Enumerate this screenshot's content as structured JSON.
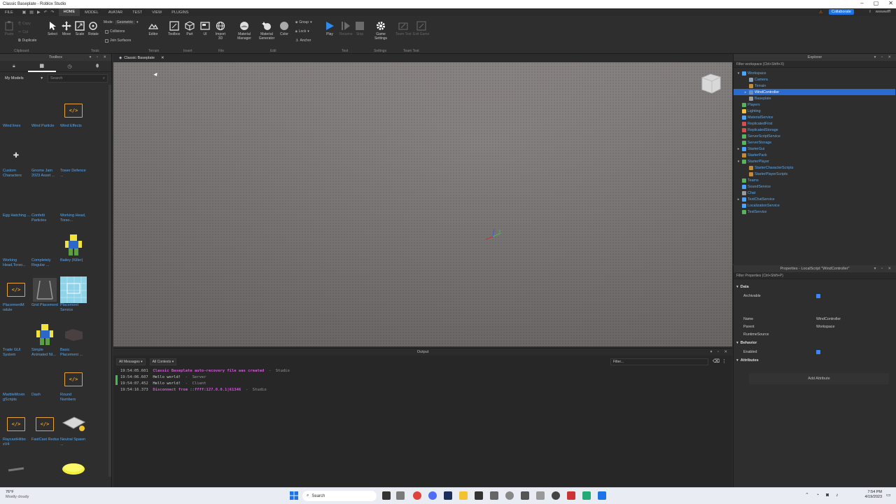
{
  "window": {
    "title": "Classic Baseplate - Roblox Studio"
  },
  "menubar": {
    "items": [
      "FILE",
      "HOME",
      "MODEL",
      "AVATAR",
      "TEST",
      "VIEW",
      "PLUGINS"
    ],
    "active": "HOME",
    "collaborate": "Collaborate",
    "user": "wwwwefff"
  },
  "ribbon": {
    "clipboard": {
      "copy": "Copy",
      "cut": "Cut",
      "duplicate": "Duplicate",
      "paste": "Paste",
      "label": "Clipboard"
    },
    "tools": {
      "select": "Select",
      "move": "Move",
      "scale": "Scale",
      "rotate": "Rotate",
      "mode_label": "Mode:",
      "mode_value": "Geometric",
      "collisions": "Collisions",
      "join_surfaces": "Join Surfaces",
      "label": "Tools"
    },
    "terrain": {
      "editor": "Editor",
      "label": "Terrain"
    },
    "insert": {
      "toolbox": "Toolbox",
      "part": "Part",
      "ui": "UI",
      "import3d": "Import 3D",
      "label": "Insert"
    },
    "file": {
      "material_manager": "Material Manager",
      "label": "File"
    },
    "edit": {
      "material_generator": "Material Generator",
      "color": "Color",
      "group": "Group",
      "lock": "Lock",
      "anchor": "Anchor",
      "label": "Edit"
    },
    "test": {
      "play": "Play",
      "resume": "Resume",
      "stop": "Stop",
      "label": "Test"
    },
    "settings": {
      "game_settings": "Game Settings",
      "label": "Settings"
    },
    "team_test": {
      "team_test": "Team Test",
      "exit_game": "Exit Game",
      "label": "Team Test"
    }
  },
  "toolbox": {
    "title": "Toolbox",
    "category": "My Models",
    "search_placeholder": "Search",
    "items": [
      {
        "label": "Wind lines",
        "thumb": "none"
      },
      {
        "label": "Wind Particle",
        "thumb": "none"
      },
      {
        "label": "Wind Effects",
        "thumb": "script"
      },
      {
        "label": "Custom Characters",
        "thumb": "figure"
      },
      {
        "label": "Gnome Jam 2023 Asset ...",
        "thumb": "none"
      },
      {
        "label": "Tower Defence ...",
        "thumb": "none"
      },
      {
        "label": "Egg Hatching ...",
        "thumb": "none"
      },
      {
        "label": "Confetti Particles",
        "thumb": "none"
      },
      {
        "label": "Working Head, Torso...",
        "thumb": "none"
      },
      {
        "label": "Working Head,Torso...",
        "thumb": "none"
      },
      {
        "label": "Completely Regular ...",
        "thumb": "none"
      },
      {
        "label": "Bailey (Killer)",
        "thumb": "noob"
      },
      {
        "label": "PlacementM odule",
        "thumb": "script"
      },
      {
        "label": "Grid Placement",
        "thumb": "grid"
      },
      {
        "label": "Placement Service",
        "thumb": "blueprint"
      },
      {
        "label": "Trade GUI System",
        "thumb": "none"
      },
      {
        "label": "Simple Animated NI...",
        "thumb": "noob"
      },
      {
        "label": "Basic Placement ...",
        "thumb": "box"
      },
      {
        "label": "MarbleMovin gScripts",
        "thumb": "none"
      },
      {
        "label": "Dash",
        "thumb": "none"
      },
      {
        "label": "Round Numbers",
        "thumb": "script"
      },
      {
        "label": "RaycastHitbo xV4",
        "thumb": "script"
      },
      {
        "label": "FastCast Redux",
        "thumb": "script"
      },
      {
        "label": "Neutral Spawn ...",
        "thumb": "spawn"
      },
      {
        "label": "",
        "thumb": "bar"
      },
      {
        "label": "",
        "thumb": "none"
      },
      {
        "label": "",
        "thumb": "disc"
      }
    ]
  },
  "doc_tab": {
    "label": "Classic Baseplate"
  },
  "output": {
    "title": "Output",
    "filter_messages": "All Messages",
    "filter_contexts": "All Contexts",
    "filter_placeholder": "Filter...",
    "lines": [
      {
        "time": "19:54:05.601",
        "msg": "Classic Baseplate auto-recovery file was created",
        "src": "Studio",
        "style": "mag"
      },
      {
        "time": "19:54:06.607",
        "msg": "Hello world!",
        "src": "Server",
        "style": "normal"
      },
      {
        "time": "19:54:07.452",
        "msg": "Hello world!",
        "src": "Client",
        "style": "normal"
      },
      {
        "time": "19:54:16.373",
        "msg": "Disconnect from ::ffff:127.0.0.1|61346",
        "src": "Studio",
        "style": "mag"
      }
    ]
  },
  "explorer": {
    "title": "Explorer",
    "filter_placeholder": "Filter workspace (Ctrl+Shift+X)",
    "tree": [
      {
        "label": "Workspace",
        "depth": 0,
        "arrow": "▾",
        "color": "#4aa3ff"
      },
      {
        "label": "Camera",
        "depth": 1,
        "arrow": "",
        "color": "#8aa0b8"
      },
      {
        "label": "Terrain",
        "depth": 1,
        "arrow": "",
        "color": "#c48a3a"
      },
      {
        "label": "WindController",
        "depth": 1,
        "arrow": "▸",
        "color": "#6a8fc0",
        "selected": true
      },
      {
        "label": "Baseplate",
        "depth": 1,
        "arrow": "",
        "color": "#9a9a9a"
      },
      {
        "label": "Players",
        "depth": 0,
        "arrow": "",
        "color": "#58b35e"
      },
      {
        "label": "Lighting",
        "depth": 0,
        "arrow": "",
        "color": "#f0c040"
      },
      {
        "label": "MaterialService",
        "depth": 0,
        "arrow": "",
        "color": "#4aa3ff"
      },
      {
        "label": "ReplicatedFirst",
        "depth": 0,
        "arrow": "",
        "color": "#d05050"
      },
      {
        "label": "ReplicatedStorage",
        "depth": 0,
        "arrow": "",
        "color": "#d05050"
      },
      {
        "label": "ServerScriptService",
        "depth": 0,
        "arrow": "",
        "color": "#58b35e"
      },
      {
        "label": "ServerStorage",
        "depth": 0,
        "arrow": "",
        "color": "#58b35e"
      },
      {
        "label": "StarterGui",
        "depth": 0,
        "arrow": "▸",
        "color": "#4aa3ff"
      },
      {
        "label": "StarterPack",
        "depth": 0,
        "arrow": "",
        "color": "#c48a3a"
      },
      {
        "label": "StarterPlayer",
        "depth": 0,
        "arrow": "▾",
        "color": "#58b35e"
      },
      {
        "label": "StarterCharacterScripts",
        "depth": 1,
        "arrow": "",
        "color": "#c48a3a"
      },
      {
        "label": "StarterPlayerScripts",
        "depth": 1,
        "arrow": "",
        "color": "#c48a3a"
      },
      {
        "label": "Teams",
        "depth": 0,
        "arrow": "",
        "color": "#58b35e"
      },
      {
        "label": "SoundService",
        "depth": 0,
        "arrow": "",
        "color": "#4aa3ff"
      },
      {
        "label": "Chat",
        "depth": 0,
        "arrow": "",
        "color": "#9a9a9a"
      },
      {
        "label": "TextChatService",
        "depth": 0,
        "arrow": "▸",
        "color": "#4aa3ff"
      },
      {
        "label": "LocalizationService",
        "depth": 0,
        "arrow": "",
        "color": "#4aa3ff"
      },
      {
        "label": "TestService",
        "depth": 0,
        "arrow": "",
        "color": "#58b35e"
      }
    ]
  },
  "properties": {
    "title": "Properties - LocalScript \"WindController\"",
    "filter_placeholder": "Filter Properties (Ctrl+Shift+P)",
    "section_data": "Data",
    "archivable": "Archivable",
    "name_label": "Name",
    "name_value": "WindController",
    "parent_label": "Parent",
    "parent_value": "Workspace",
    "runtime_source": "RuntimeSource",
    "section_behavior": "Behavior",
    "enabled": "Enabled",
    "section_attributes": "Attributes",
    "add_attribute": "Add Attribute"
  },
  "taskbar": {
    "weather_temp": "76°F",
    "weather_desc": "Mostly cloudy",
    "search": "Search",
    "time": "7:54 PM",
    "date": "4/19/2023"
  },
  "colors": {
    "accent": "#1a73e8",
    "selection": "#2a6bd0",
    "script_orange": "#e8a23a",
    "output_magenta": "#d257d8"
  }
}
